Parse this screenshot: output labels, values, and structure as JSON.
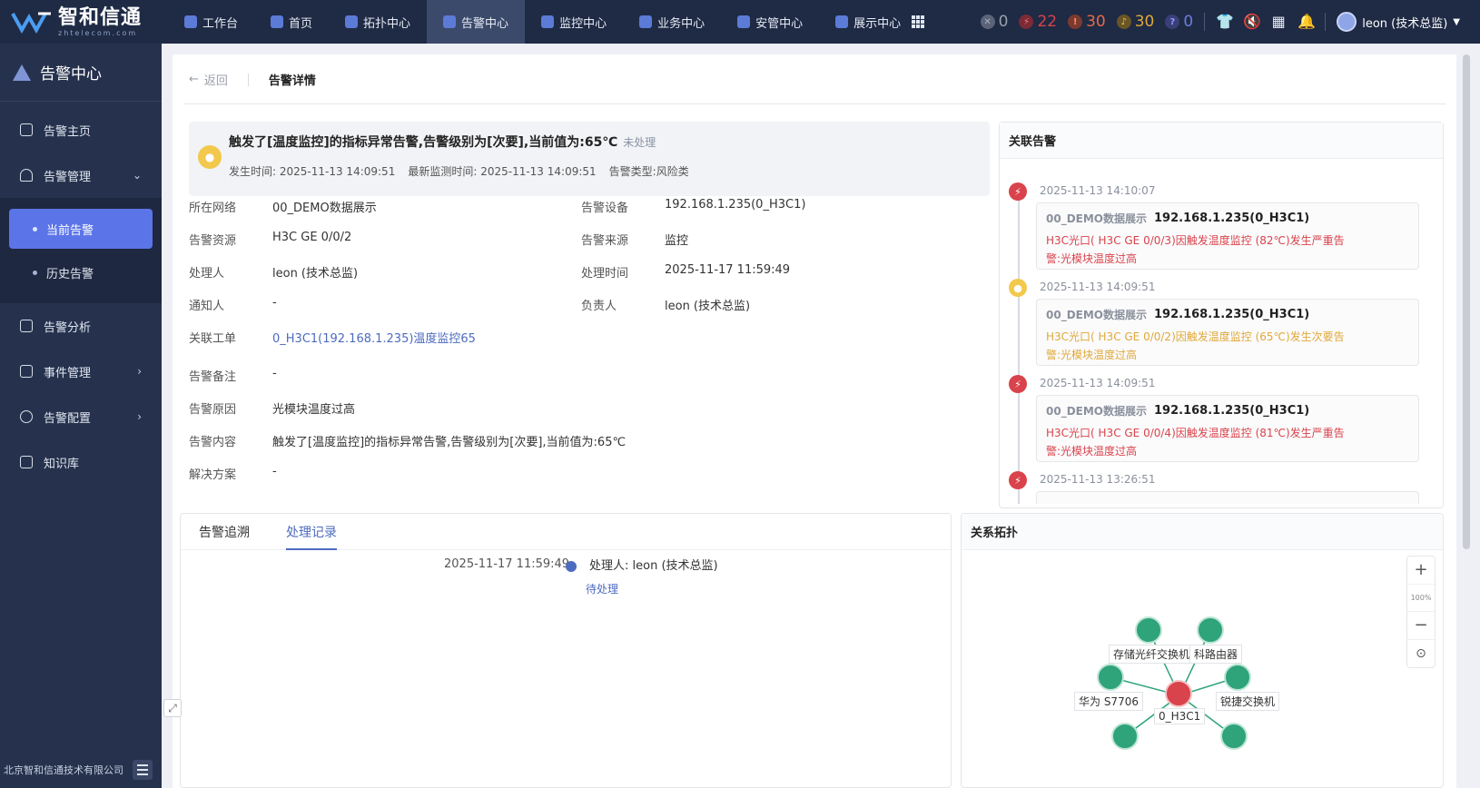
{
  "brand": {
    "name_cn": "智和信通",
    "name_en": "zhtelecom.com"
  },
  "nav": {
    "items": [
      {
        "label": "工作台"
      },
      {
        "label": "首页"
      },
      {
        "label": "拓扑中心"
      },
      {
        "label": "告警中心"
      },
      {
        "label": "监控中心"
      },
      {
        "label": "业务中心"
      },
      {
        "label": "安管中心"
      },
      {
        "label": "展示中心"
      }
    ]
  },
  "alarm_counts": [
    {
      "icon": "close-circle-icon",
      "value": "0",
      "color": "#9aa1ad"
    },
    {
      "icon": "bolt-icon",
      "value": "22",
      "color": "#d9434b"
    },
    {
      "icon": "exclamation-icon",
      "value": "30",
      "color": "#e36b4a"
    },
    {
      "icon": "bell-icon",
      "value": "30",
      "color": "#e0a83a"
    },
    {
      "icon": "question-icon",
      "value": "0",
      "color": "#6b7de0"
    }
  ],
  "user": {
    "name": "leon (技术总监)"
  },
  "sidebar": {
    "title": "告警中心",
    "items": [
      {
        "label": "告警主页"
      },
      {
        "label": "告警管理"
      },
      {
        "label": "当前告警"
      },
      {
        "label": "历史告警"
      },
      {
        "label": "告警分析"
      },
      {
        "label": "事件管理"
      },
      {
        "label": "告警配置"
      },
      {
        "label": "知识库"
      }
    ],
    "footer": "北京智和信通技术有限公司"
  },
  "page": {
    "back": "返回",
    "title": "告警详情"
  },
  "alert": {
    "title": "触发了[温度监控]的指标异常告警,告警级别为[次要],当前值为:65℃",
    "status": "未处理",
    "occur_label": "发生时间:",
    "occur_time": "2025-11-13 14:09:51",
    "latest_label": "最新监测时间:",
    "latest_time": "2025-11-13 14:09:51",
    "type_label": "告警类型:",
    "type": "风险类"
  },
  "fields": {
    "network_label": "所在网络",
    "network": "00_DEMO数据展示",
    "device_label": "告警设备",
    "device": "192.168.1.235(0_H3C1)",
    "resource_label": "告警资源",
    "resource": "H3C GE 0/0/2",
    "source_label": "告警来源",
    "source": "监控",
    "handler_label": "处理人",
    "handler": "leon (技术总监)",
    "handle_time_label": "处理时间",
    "handle_time": "2025-11-17 11:59:49",
    "notify_label": "通知人",
    "notify": "-",
    "owner_label": "负责人",
    "owner": "leon (技术总监)",
    "ticket_label": "关联工单",
    "ticket": "0_H3C1(192.168.1.235)温度监控65",
    "remark_label": "告警备注",
    "remark": "-",
    "reason_label": "告警原因",
    "reason": "光模块温度过高",
    "content_label": "告警内容",
    "content": "触发了[温度监控]的指标异常告警,告警级别为[次要],当前值为:65℃",
    "solution_label": "解决方案",
    "solution": "-"
  },
  "related": {
    "title": "关联告警",
    "items": [
      {
        "time": "2025-11-13 14:10:07",
        "network": "00_DEMO数据展示",
        "device": "192.168.1.235(0_H3C1)",
        "msg1": "H3C光口( H3C GE 0/0/3)因触发温度监控 (82℃)发生严重告",
        "msg2": "警:光模块温度过高",
        "level": "严重"
      },
      {
        "time": "2025-11-13 14:09:51",
        "network": "00_DEMO数据展示",
        "device": "192.168.1.235(0_H3C1)",
        "msg1": "H3C光口( H3C GE 0/0/2)因触发温度监控 (65℃)发生次要告",
        "msg2": "警:光模块温度过高",
        "level": "次要"
      },
      {
        "time": "2025-11-13 14:09:51",
        "network": "00_DEMO数据展示",
        "device": "192.168.1.235(0_H3C1)",
        "msg1": "H3C光口( H3C GE 0/0/4)因触发温度监控 (81℃)发生严重告",
        "msg2": "警:光模块温度过高",
        "level": "严重"
      },
      {
        "time": "2025-11-13 13:26:51"
      }
    ]
  },
  "tabs": {
    "trace": "告警追溯",
    "records": "处理记录"
  },
  "record": {
    "time": "2025-11-17 11:59:49",
    "handler_label": "处理人:",
    "handler": "leon (技术总监)",
    "status": "待处理"
  },
  "topology": {
    "title": "关系拓扑",
    "zoom": "100%",
    "nodes": [
      {
        "label": "存储光纤交换机"
      },
      {
        "label": "科路由器"
      },
      {
        "label": "华为 S7706"
      },
      {
        "label": "0_H3C1"
      },
      {
        "label": "锐捷交换机"
      }
    ]
  },
  "colors": {
    "accent": "#5b74e8",
    "critical": "#d9434b",
    "minor": "#f2c94c"
  }
}
